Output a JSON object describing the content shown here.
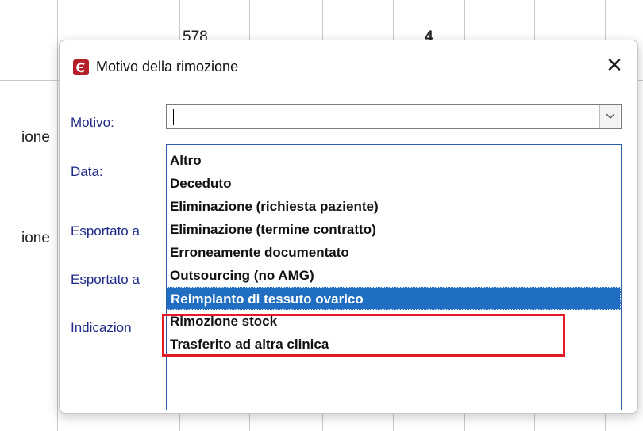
{
  "background": {
    "cell_top_number": "578",
    "cell_top_bold": "4",
    "row_label_1": "ione",
    "row_label_2": "ione"
  },
  "dialog": {
    "title": "Motivo della rimozione",
    "close_glyph": "✕",
    "labels": {
      "motivo": "Motivo:",
      "data": "Data:",
      "esportato_1": "Esportato a",
      "esportato_2": "Esportato a",
      "indicazioni": "Indicazion"
    },
    "combo": {
      "value": ""
    },
    "options": [
      "Altro",
      "Deceduto",
      "Eliminazione (richiesta paziente)",
      "Eliminazione (termine contratto)",
      "Erroneamente documentato",
      "Outsourcing (no AMG)",
      "Reimpianto di tessuto ovarico",
      "Rimozione stock",
      "Trasferito ad altra clinica"
    ],
    "selected_option": "Reimpianto di tessuto ovarico"
  },
  "colors": {
    "selection": "#1f6ec1",
    "annotation": "#e21b24",
    "label_text": "#1e2a8a",
    "app_icon": "#b51f2a"
  }
}
